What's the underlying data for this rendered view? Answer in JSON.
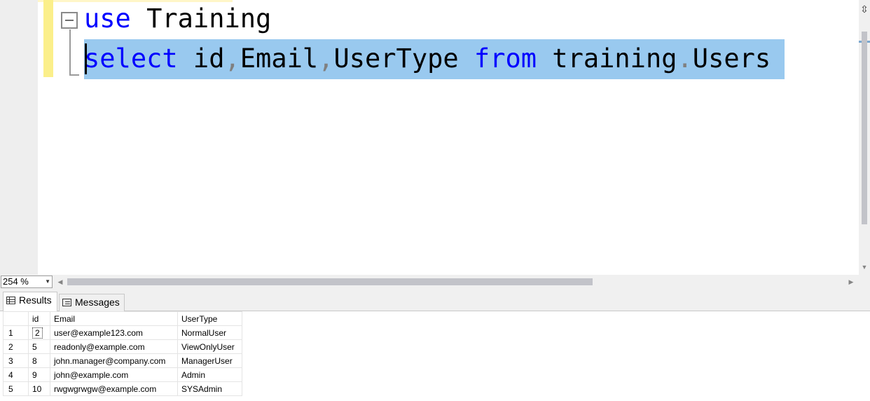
{
  "editor": {
    "line1": {
      "keyword": "use",
      "text": " Training"
    },
    "line2": {
      "kw_select": "select",
      "col1": " id",
      "comma1": ",",
      "col2": "Email",
      "comma2": ",",
      "col3": "UserType ",
      "kw_from": "from",
      "schema": " training",
      "dot": ".",
      "table": "Users"
    },
    "colors": {
      "keyword": "#0000ff",
      "punctuation": "#808080",
      "selection": "#99c9ef"
    }
  },
  "status": {
    "zoom": "254 %"
  },
  "tabs": [
    {
      "label": "Results",
      "icon": "grid-icon"
    },
    {
      "label": "Messages",
      "icon": "messages-icon"
    }
  ],
  "results": {
    "columns": [
      "id",
      "Email",
      "UserType"
    ],
    "rows": [
      {
        "num": "1",
        "id": "2",
        "email": "user@example123.com",
        "type": "NormalUser"
      },
      {
        "num": "2",
        "id": "5",
        "email": "readonly@example.com",
        "type": "ViewOnlyUser"
      },
      {
        "num": "3",
        "id": "8",
        "email": "john.manager@company.com",
        "type": "ManagerUser"
      },
      {
        "num": "4",
        "id": "9",
        "email": "john@example.com",
        "type": "Admin"
      },
      {
        "num": "5",
        "id": "10",
        "email": "rwgwgrwgw@example.com",
        "type": "SYSAdmin"
      }
    ]
  }
}
